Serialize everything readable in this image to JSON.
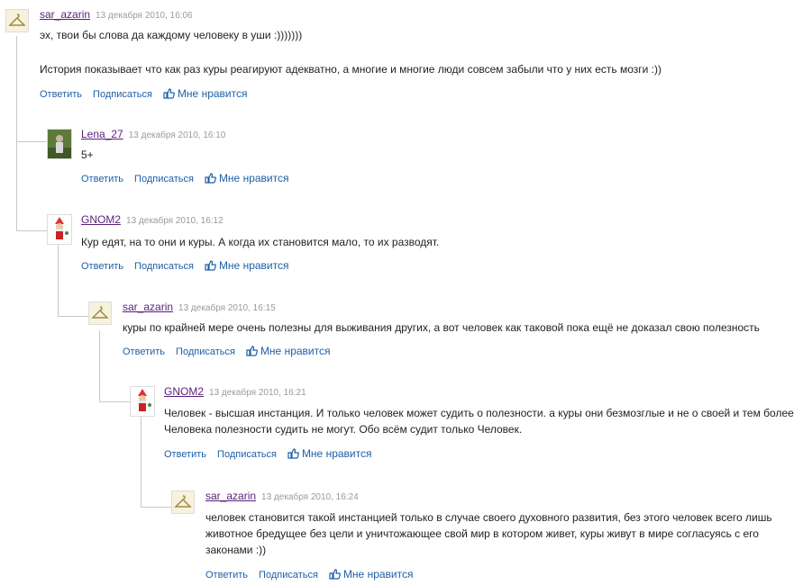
{
  "comments": [
    {
      "author": "sar_azarin",
      "date": "13 декабря 2010, 16:06",
      "lines": [
        "эх, твои бы слова да каждому человеку в уши :)))))))",
        "",
        "История показывает что как раз куры реагируют адекватно, а многие и многие люди совсем забыли что у них есть мозги :))"
      ],
      "avatar_icon": "hanger-icon",
      "reply": "Ответить",
      "subscribe": "Подписаться",
      "like": "Мне нравится"
    },
    {
      "author": "Lena_27",
      "date": "13 декабря 2010, 16:10",
      "lines": [
        "5+"
      ],
      "avatar_icon": "photo-avatar-icon",
      "reply": "Ответить",
      "subscribe": "Подписаться",
      "like": "Мне нравится"
    },
    {
      "author": "GNOM2",
      "date": "13 декабря 2010, 16:12",
      "lines": [
        "Кур едят, на то они и куры. А когда их становится мало, то их разводят."
      ],
      "avatar_icon": "gnome-icon",
      "reply": "Ответить",
      "subscribe": "Подписаться",
      "like": "Мне нравится"
    },
    {
      "author": "sar_azarin",
      "date": "13 декабря 2010, 16:15",
      "lines": [
        "куры по крайней мере очень полезны для выживания других, а вот человек как таковой пока ещё не доказал свою полезность"
      ],
      "avatar_icon": "hanger-icon",
      "reply": "Ответить",
      "subscribe": "Подписаться",
      "like": "Мне нравится"
    },
    {
      "author": "GNOM2",
      "date": "13 декабря 2010, 16:21",
      "lines": [
        "Человек - высшая инстанция. И только человек может судить о полезности. а куры они безмозглые и не о своей и тем более",
        "Человека полезности судить не могут. Обо всём судит только Человек."
      ],
      "avatar_icon": "gnome-icon",
      "reply": "Ответить",
      "subscribe": "Подписаться",
      "like": "Мне нравится"
    },
    {
      "author": "sar_azarin",
      "date": "13 декабря 2010, 16:24",
      "lines": [
        "человек становится такой инстанцией только в случае своего духовного развития, без этого человек всего лишь",
        "животное бредущее без цели и уничтожающее свой мир в котором живет, куры живут в мире согласуясь с его",
        "законами :))"
      ],
      "avatar_icon": "hanger-icon",
      "reply": "Ответить",
      "subscribe": "Подписаться",
      "like": "Мне нравится"
    }
  ],
  "colors": {
    "author": "#5a1f7a",
    "link": "#1f5fa8",
    "date": "#9a9a9a"
  },
  "like_icon": "thumbs-up-icon"
}
